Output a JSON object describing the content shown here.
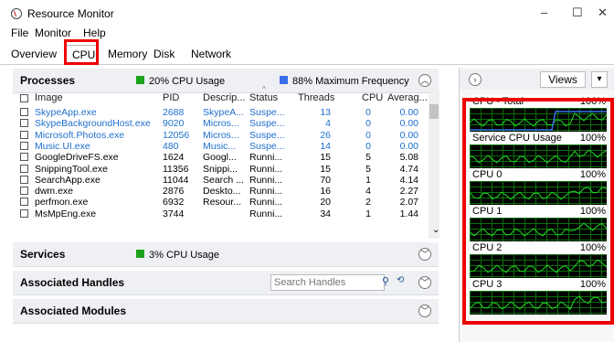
{
  "window": {
    "title": "Resource Monitor",
    "minimize": "–",
    "maximize": "☐",
    "close": "✕"
  },
  "menu": [
    "File",
    "Monitor",
    "Help"
  ],
  "tabs": [
    "Overview",
    "CPU",
    "Memory",
    "Disk",
    "Network"
  ],
  "active_tab": "CPU",
  "processes": {
    "title": "Processes",
    "cpu_usage": "20% CPU Usage",
    "max_freq": "88% Maximum Frequency",
    "columns": [
      "Image",
      "PID",
      "Descrip...",
      "Status",
      "Threads",
      "CPU",
      "Averag..."
    ],
    "rows": [
      {
        "image": "SkypeApp.exe",
        "pid": "2688",
        "desc": "SkypeA...",
        "status": "Suspe...",
        "threads": "13",
        "cpu": "0",
        "avg": "0.00",
        "suspended": true
      },
      {
        "image": "SkypeBackgroundHost.exe",
        "pid": "9020",
        "desc": "Micros...",
        "status": "Suspe...",
        "threads": "4",
        "cpu": "0",
        "avg": "0.00",
        "suspended": true
      },
      {
        "image": "Microsoft.Photos.exe",
        "pid": "12056",
        "desc": "Micros...",
        "status": "Suspe...",
        "threads": "26",
        "cpu": "0",
        "avg": "0.00",
        "suspended": true
      },
      {
        "image": "Music.UI.exe",
        "pid": "480",
        "desc": "Music...",
        "status": "Suspe...",
        "threads": "14",
        "cpu": "0",
        "avg": "0.00",
        "suspended": true
      },
      {
        "image": "GoogleDriveFS.exe",
        "pid": "1624",
        "desc": "Googl...",
        "status": "Runni...",
        "threads": "15",
        "cpu": "5",
        "avg": "5.08",
        "suspended": false
      },
      {
        "image": "SnippingTool.exe",
        "pid": "11356",
        "desc": "Snippi...",
        "status": "Runni...",
        "threads": "15",
        "cpu": "5",
        "avg": "4.74",
        "suspended": false
      },
      {
        "image": "SearchApp.exe",
        "pid": "11044",
        "desc": "Search ...",
        "status": "Runni...",
        "threads": "70",
        "cpu": "1",
        "avg": "4.14",
        "suspended": false
      },
      {
        "image": "dwm.exe",
        "pid": "2876",
        "desc": "Deskto...",
        "status": "Runni...",
        "threads": "16",
        "cpu": "4",
        "avg": "2.27",
        "suspended": false
      },
      {
        "image": "perfmon.exe",
        "pid": "6932",
        "desc": "Resour...",
        "status": "Runni...",
        "threads": "20",
        "cpu": "2",
        "avg": "2.07",
        "suspended": false
      },
      {
        "image": "MsMpEng.exe",
        "pid": "3744",
        "desc": "",
        "status": "Runni...",
        "threads": "34",
        "cpu": "1",
        "avg": "1.44",
        "suspended": false
      }
    ]
  },
  "services": {
    "title": "Services",
    "cpu_usage": "3% CPU Usage"
  },
  "handles": {
    "title": "Associated Handles",
    "search_placeholder": "Search Handles"
  },
  "modules": {
    "title": "Associated Modules"
  },
  "right_panel": {
    "views_label": "Views",
    "graphs": [
      {
        "name": "CPU - Total",
        "pct": "100%"
      },
      {
        "name": "Service CPU Usage",
        "pct": "100%"
      },
      {
        "name": "CPU 0",
        "pct": "100%"
      },
      {
        "name": "CPU 1",
        "pct": "100%"
      },
      {
        "name": "CPU 2",
        "pct": "100%"
      },
      {
        "name": "CPU 3",
        "pct": "100%"
      }
    ]
  },
  "colors": {
    "accent": "#1e6fcc",
    "highlight": "#e00000",
    "graph_grid": "#0b6e0b",
    "graph_line": "#22dd22",
    "freq_line": "#3a6ee8"
  }
}
